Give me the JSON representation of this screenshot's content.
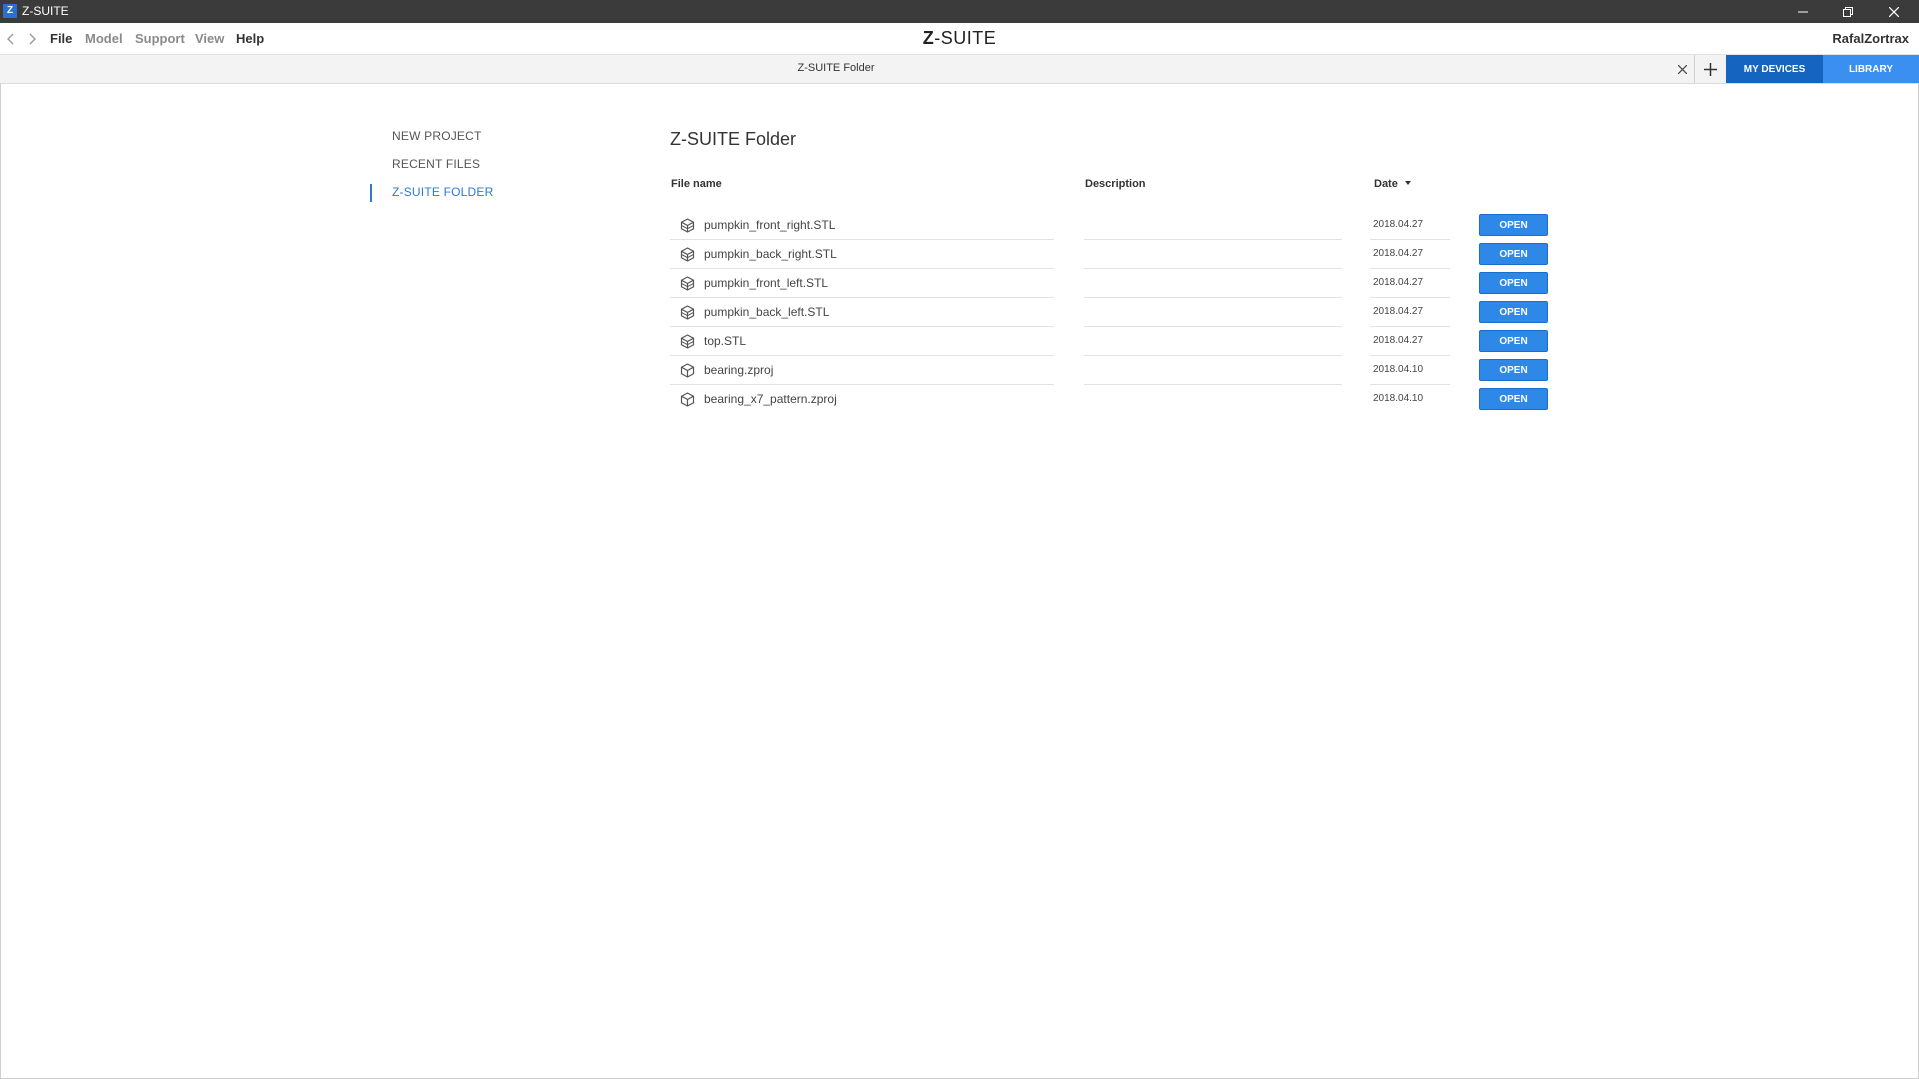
{
  "window": {
    "app_icon_letter": "Z",
    "title": "Z-SUITE"
  },
  "menubar": {
    "items": [
      {
        "label": "File",
        "state": "active"
      },
      {
        "label": "Model",
        "state": "disabled"
      },
      {
        "label": "Support",
        "state": "disabled"
      },
      {
        "label": "View",
        "state": "disabled"
      },
      {
        "label": "Help",
        "state": "active"
      }
    ],
    "brand_prefix": "Z",
    "brand_suffix": "-SUITE",
    "username": "RafalZortrax"
  },
  "tabbar": {
    "tab_title": "Z-SUITE Folder",
    "my_devices_label": "MY DEVICES",
    "library_label": "LIBRARY"
  },
  "left_nav": {
    "items": [
      {
        "label": "NEW PROJECT",
        "active": false
      },
      {
        "label": "RECENT FILES",
        "active": false
      },
      {
        "label": "Z-SUITE FOLDER",
        "active": true
      }
    ]
  },
  "main": {
    "title": "Z-SUITE Folder",
    "columns": {
      "file_name": "File name",
      "description": "Description",
      "date": "Date"
    },
    "sort": {
      "column": "date",
      "direction": "descending"
    },
    "files": [
      {
        "name": "pumpkin_front_right.STL",
        "description": "",
        "date": "2018.04.27",
        "type": "stl",
        "open_label": "OPEN"
      },
      {
        "name": "pumpkin_back_right.STL",
        "description": "",
        "date": "2018.04.27",
        "type": "stl",
        "open_label": "OPEN"
      },
      {
        "name": "pumpkin_front_left.STL",
        "description": "",
        "date": "2018.04.27",
        "type": "stl",
        "open_label": "OPEN"
      },
      {
        "name": "pumpkin_back_left.STL",
        "description": "",
        "date": "2018.04.27",
        "type": "stl",
        "open_label": "OPEN"
      },
      {
        "name": "top.STL",
        "description": "",
        "date": "2018.04.27",
        "type": "stl",
        "open_label": "OPEN"
      },
      {
        "name": "bearing.zproj",
        "description": "",
        "date": "2018.04.10",
        "type": "zproj",
        "open_label": "OPEN"
      },
      {
        "name": "bearing_x7_pattern.zproj",
        "description": "",
        "date": "2018.04.10",
        "type": "zproj",
        "open_label": "OPEN"
      }
    ]
  },
  "colors": {
    "accent": "#2e88e8",
    "my_devices_bg": "#1565c0",
    "library_bg": "#3b8ff0",
    "titlebar_bg": "#3b3b3b",
    "nav_active": "#2e7ad1"
  }
}
